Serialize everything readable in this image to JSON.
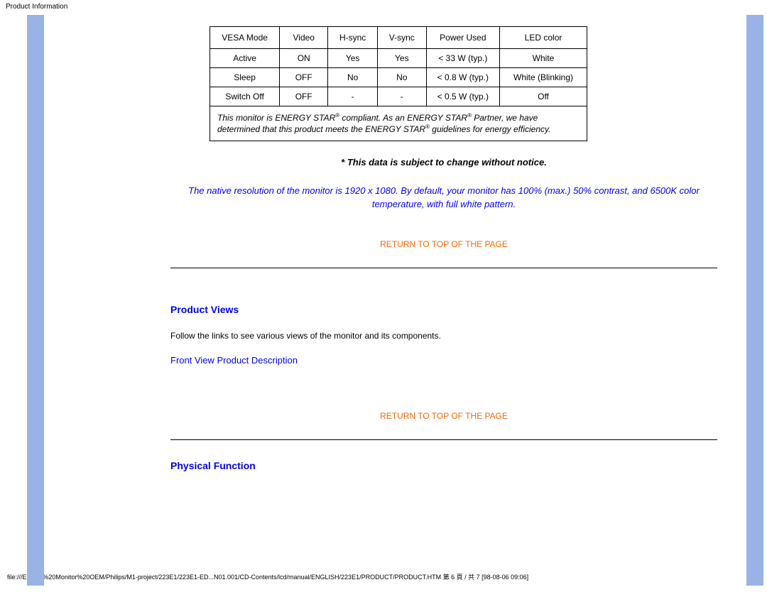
{
  "browser_title": "Product Information",
  "table": {
    "headers": [
      "VESA Mode",
      "Video",
      "H-sync",
      "V-sync",
      "Power Used",
      "LED color"
    ],
    "rows": [
      [
        "Active",
        "ON",
        "Yes",
        "Yes",
        "< 33 W (typ.)",
        "White"
      ],
      [
        "Sleep",
        "OFF",
        "No",
        "No",
        "< 0.8 W (typ.)",
        "White (Blinking)"
      ],
      [
        "Switch Off",
        "OFF",
        "-",
        "-",
        "< 0.5 W (typ.)",
        "Off"
      ]
    ],
    "note_pre": "This monitor is ENERGY STAR",
    "note_mid": " compliant. As an ENERGY STAR",
    "note_post": " Partner, we have determined that this product meets the ENERGY STAR",
    "note_end": " guidelines for energy efficiency.",
    "reg": "®"
  },
  "disclaimer": "* This data is subject to change without notice.",
  "native_note": "The native resolution of the monitor is 1920 x 1080. By default, your monitor has 100% (max.) 50% contrast, and 6500K color temperature, with full white pattern.",
  "return_link": "RETURN TO TOP OF THE PAGE",
  "sections": {
    "product_views": {
      "title": "Product Views",
      "desc": "Follow the links to see various views of the monitor and its components.",
      "link": "Front View Product Description"
    },
    "physical": {
      "title": "Physical Function"
    }
  },
  "footer": "file:///E|/LCD%20Monitor%20OEM/Philips/M1-project/223E1/223E1-ED...N01.001/CD-Contents/lcd/manual/ENGLISH/223E1/PRODUCT/PRODUCT.HTM 第 6 頁 / 共 7 [98-08-06 09:06]"
}
